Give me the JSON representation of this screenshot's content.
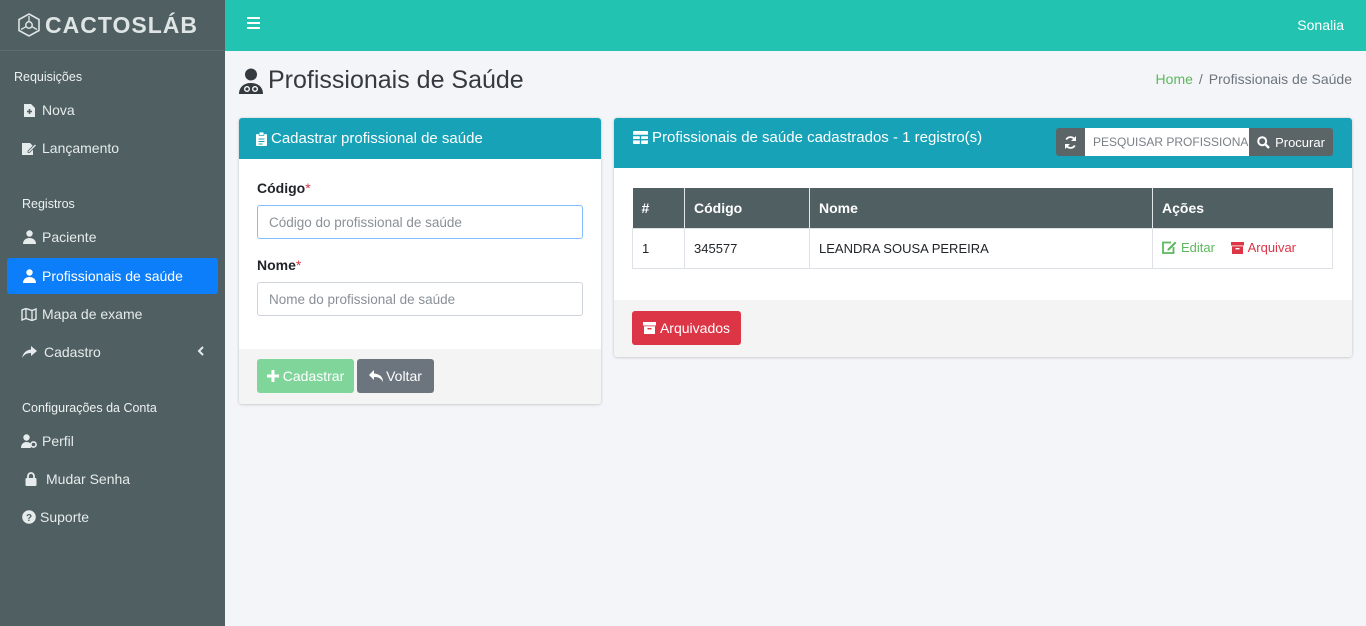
{
  "brand": {
    "name": "CACTOSLÁB"
  },
  "topbar": {
    "user": "Sonalia"
  },
  "sidebar": {
    "sections": [
      {
        "title": "Requisições"
      },
      {
        "title": "Registros"
      },
      {
        "title": "Configurações da Conta"
      }
    ],
    "items": [
      {
        "label": "Nova",
        "icon": "file-plus-icon"
      },
      {
        "label": "Lançamento",
        "icon": "edit-doc-icon"
      },
      {
        "label": "Paciente",
        "icon": "user-injured-icon"
      },
      {
        "label": "Profissionais de saúde",
        "icon": "user-md-icon",
        "active": true
      },
      {
        "label": "Mapa de exame",
        "icon": "map-icon"
      },
      {
        "label": "Cadastro",
        "icon": "share-icon"
      },
      {
        "label": "Perfil",
        "icon": "user-cog-icon"
      },
      {
        "label": "Mudar Senha",
        "icon": "lock-icon"
      },
      {
        "label": "Suporte",
        "icon": "question-circle-icon"
      }
    ]
  },
  "page": {
    "title": "Profissionais de Saúde",
    "breadcrumb": {
      "home": "Home",
      "current": "Profissionais de Saúde"
    }
  },
  "form_card": {
    "title": "Cadastrar profissional de saúde",
    "codigo_label": "Código",
    "codigo_placeholder": "Código do profissional de saúde",
    "codigo_value": "",
    "nome_label": "Nome",
    "nome_placeholder": "Nome do profissional de saúde",
    "nome_value": "",
    "required_mark": "*",
    "submit_label": "Cadastrar",
    "back_label": "Voltar"
  },
  "list_card": {
    "title": "Profissionais de saúde cadastrados - 1 registro(s)",
    "search_placeholder": "PESQUISAR PROFISSIONAL",
    "search_label": "Procurar",
    "columns": [
      "#",
      "Código",
      "Nome",
      "Ações"
    ],
    "rows": [
      {
        "index": "1",
        "codigo": "345577",
        "nome": "LEANDRA SOUSA PEREIRA"
      }
    ],
    "edit_label": "Editar",
    "archive_label": "Arquivar",
    "archived_button": "Arquivados"
  },
  "colors": {
    "sidebar_bg": "#4f5f62",
    "topbar_bg": "#22c3b0",
    "card_header": "#17a2b8",
    "active_nav": "#0d7ef9",
    "success": "#5cb85c",
    "danger": "#dc3545"
  }
}
